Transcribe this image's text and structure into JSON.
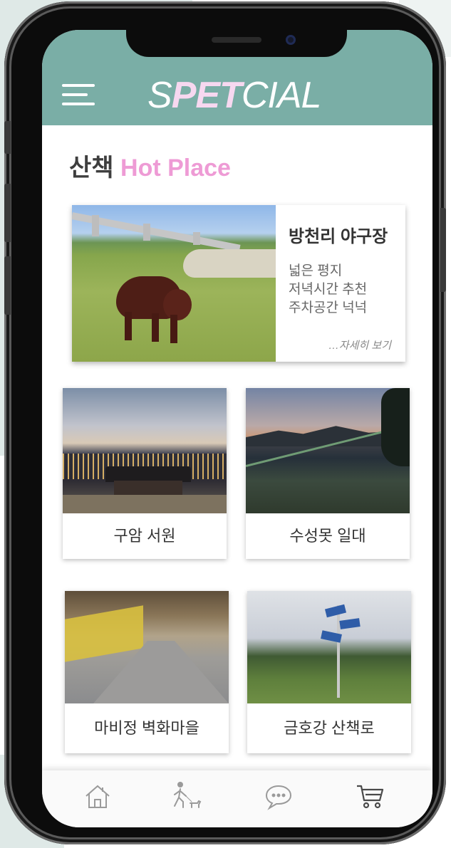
{
  "header": {
    "logo_pre": "S",
    "logo_accent": "PET",
    "logo_post": "CIAL",
    "bg_color": "#7aaea6",
    "accent_color": "#f7d8f0"
  },
  "section": {
    "title_ko": "산책",
    "title_en": "Hot Place",
    "title_en_color": "#ee9bd5"
  },
  "featured": {
    "title": "방천리 야구장",
    "details": [
      "넓은 평지",
      "저녁시간 추천",
      "주차공간 넉넉"
    ],
    "more_label": "…자세히 보기"
  },
  "places": [
    {
      "label": "구암 서원"
    },
    {
      "label": "수성못 일대"
    },
    {
      "label": "마비정 벽화마을"
    },
    {
      "label": "금호강 산책로"
    }
  ],
  "bottom_nav": {
    "items": [
      {
        "icon": "home-icon"
      },
      {
        "icon": "walk-icon"
      },
      {
        "icon": "chat-icon"
      },
      {
        "icon": "cart-icon"
      }
    ]
  }
}
